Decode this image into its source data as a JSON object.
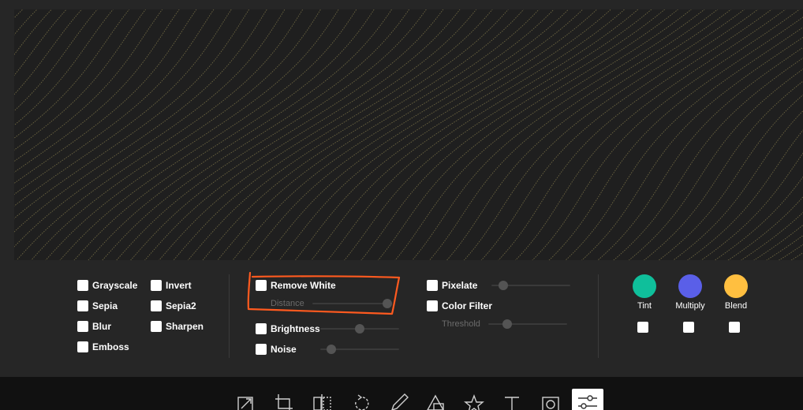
{
  "colors": {
    "tint": "#0fbf9b",
    "multiply": "#5a5fe8",
    "blend": "#ffbf40",
    "annotation": "#ff5a1f",
    "wave_line": "#6a6340"
  },
  "filters": {
    "col1": [
      {
        "label": "Grayscale",
        "checked": false
      },
      {
        "label": "Sepia",
        "checked": false
      },
      {
        "label": "Blur",
        "checked": false
      },
      {
        "label": "Emboss",
        "checked": false
      }
    ],
    "col2": [
      {
        "label": "Invert",
        "checked": false
      },
      {
        "label": "Sepia2",
        "checked": false
      },
      {
        "label": "Sharpen",
        "checked": false
      }
    ],
    "remove_white": {
      "label": "Remove White",
      "checked": false,
      "sub_label": "Distance",
      "value": 0.95
    },
    "brightness": {
      "label": "Brightness",
      "checked": false,
      "value": 0.5
    },
    "noise": {
      "label": "Noise",
      "checked": false,
      "value": 0.14
    },
    "pixelate": {
      "label": "Pixelate",
      "checked": false,
      "value": 0.15
    },
    "color_filter": {
      "label": "Color Filter",
      "checked": false,
      "sub_label": "Threshold",
      "value": 0.24
    }
  },
  "blend_modes": [
    {
      "label": "Tint",
      "color_key": "tint",
      "checked": false
    },
    {
      "label": "Multiply",
      "color_key": "multiply",
      "checked": false
    },
    {
      "label": "Blend",
      "color_key": "blend",
      "checked": false
    }
  ],
  "toolbar": {
    "tools": [
      {
        "name": "resize-icon"
      },
      {
        "name": "crop-icon"
      },
      {
        "name": "flip-icon"
      },
      {
        "name": "rotate-icon"
      },
      {
        "name": "draw-icon"
      },
      {
        "name": "shape-icon"
      },
      {
        "name": "icon-star-icon"
      },
      {
        "name": "text-icon"
      },
      {
        "name": "mask-icon"
      },
      {
        "name": "filter-icon",
        "active": true
      }
    ]
  }
}
